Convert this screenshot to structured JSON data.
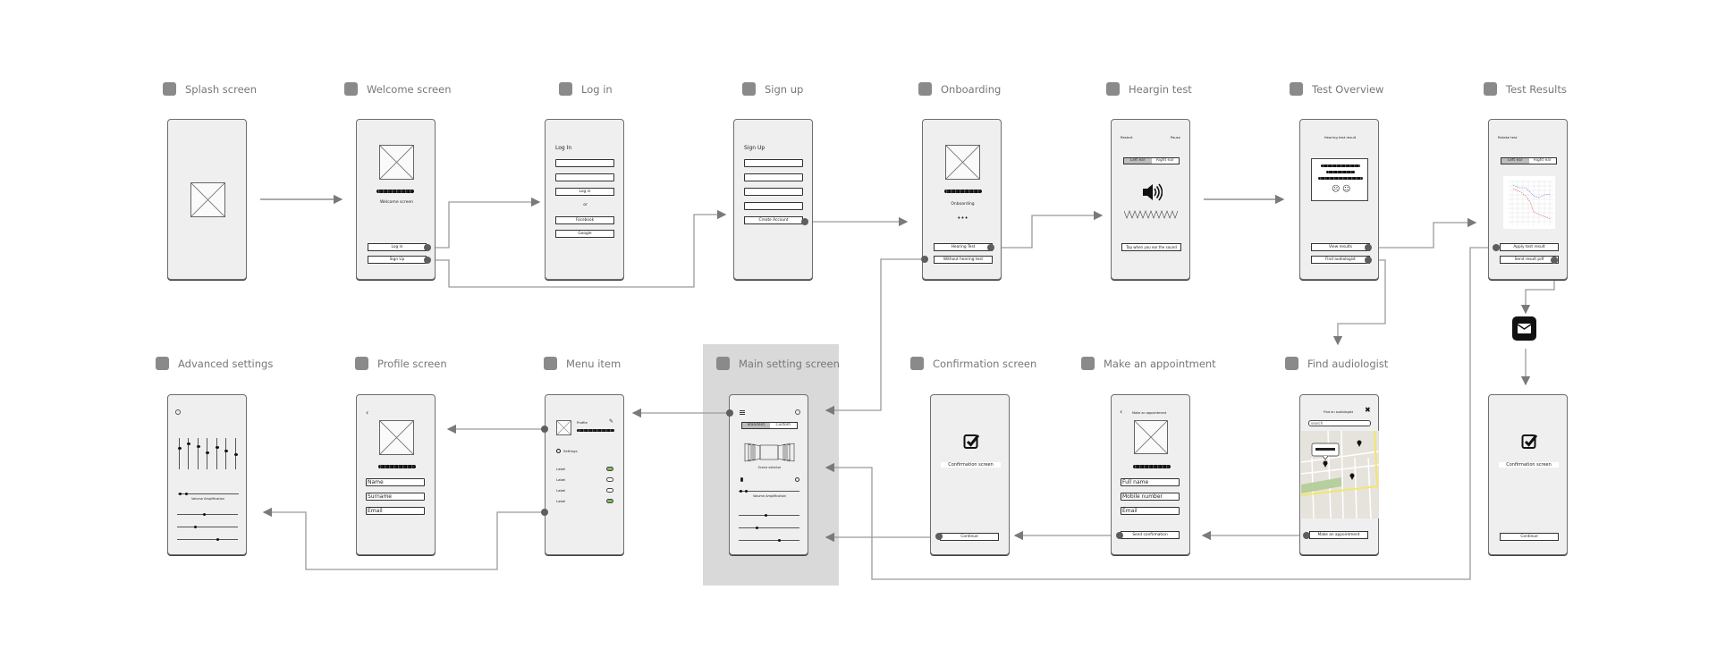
{
  "diagram": {
    "type": "wireframe-user-flow",
    "screens": [
      {
        "id": "splash",
        "title": "Splash screen"
      },
      {
        "id": "welcome",
        "title": "Welcome screen",
        "text": "Welcome screen",
        "buttons": [
          "Log in",
          "Sign Up"
        ]
      },
      {
        "id": "login",
        "title": "Log in",
        "heading": "Log In",
        "buttons": [
          "Log in",
          "Facebook",
          "Google"
        ],
        "separator": "or"
      },
      {
        "id": "signup",
        "title": "Sign up",
        "heading": "Sign Up",
        "buttons": [
          "Create Account"
        ]
      },
      {
        "id": "onboarding",
        "title": "Onboarding",
        "text": "Onboarding",
        "pager": "•••",
        "buttons": [
          "Hearing Test",
          "Without hearing test"
        ]
      },
      {
        "id": "hearing_test",
        "title": "Heargin test",
        "top_left": "Restart",
        "top_right": "Pause",
        "segments": [
          "Left ear",
          "Right ear"
        ],
        "buttons": [
          "Tap when you ear the sound"
        ]
      },
      {
        "id": "test_overview",
        "title": "Test Overview",
        "heading": "Hearing test result",
        "buttons": [
          "View results",
          "Find audiologist"
        ]
      },
      {
        "id": "test_results",
        "title": "Test Results",
        "heading": "Retake test",
        "segments": [
          "Left ear",
          "Right ear"
        ],
        "buttons": [
          "Apply test result",
          "Send result pdf"
        ]
      },
      {
        "id": "advanced_settings",
        "title": "Advanced settings",
        "slider_label": "Volume Amplification"
      },
      {
        "id": "profile",
        "title": "Profile screen",
        "fields": [
          "Name",
          "Surname",
          "Email"
        ]
      },
      {
        "id": "menu",
        "title": "Menu item",
        "profile_label": "Profile",
        "settings_label": "Settings",
        "rows": [
          {
            "label": "Label",
            "on": true
          },
          {
            "label": "Label",
            "on": false
          },
          {
            "label": "Label",
            "on": false
          },
          {
            "label": "Label",
            "on": true
          }
        ]
      },
      {
        "id": "main_setting",
        "title": "Main setting screen",
        "segments": [
          "Standard",
          "Custom"
        ],
        "scene_label": "Scene selector",
        "slider_label": "Volume Amplification"
      },
      {
        "id": "confirmation",
        "title": "Confirmation screen",
        "text": "Confirmation screen",
        "buttons": [
          "Continue"
        ]
      },
      {
        "id": "appointment",
        "title": "Make an appointment",
        "heading": "Make an appointment",
        "fields": [
          "Full name",
          "Mobile number",
          "Email"
        ],
        "buttons": [
          "Send confirmation"
        ]
      },
      {
        "id": "find_audiologist",
        "title": "Find audiologist",
        "heading": "Find an audiologist",
        "search_placeholder": "search",
        "buttons": [
          "Make an appointment"
        ]
      },
      {
        "id": "confirmation_email",
        "title": "",
        "text": "Confirmation screen",
        "buttons": [
          "Continue"
        ]
      }
    ],
    "edges": [
      {
        "from": "splash",
        "to": "welcome"
      },
      {
        "from": "welcome.Log in",
        "to": "login"
      },
      {
        "from": "welcome.Sign Up",
        "to": "signup"
      },
      {
        "from": "signup.Create Account",
        "to": "onboarding"
      },
      {
        "from": "onboarding.Hearing Test",
        "to": "hearing_test"
      },
      {
        "from": "onboarding.Without hearing test",
        "to": "main_setting"
      },
      {
        "from": "hearing_test",
        "to": "test_overview"
      },
      {
        "from": "test_overview.View results",
        "to": "test_results"
      },
      {
        "from": "test_overview.Find audiologist",
        "to": "find_audiologist"
      },
      {
        "from": "test_results.Send result pdf",
        "to": "email"
      },
      {
        "from": "email",
        "to": "confirmation_email"
      },
      {
        "from": "test_results.Apply test result",
        "to": "main_setting"
      },
      {
        "from": "find_audiologist.Make an appointment",
        "to": "appointment"
      },
      {
        "from": "appointment.Send confirmation",
        "to": "confirmation"
      },
      {
        "from": "confirmation.Continue",
        "to": "main_setting"
      },
      {
        "from": "main_setting.menu",
        "to": "menu"
      },
      {
        "from": "menu.Profile",
        "to": "profile"
      },
      {
        "from": "menu.Settings",
        "to": "advanced_settings"
      }
    ],
    "colors": {
      "frame_fill": "#efefef",
      "connector": "#9a9a9a",
      "highlight": "#d9d9d9",
      "toggle_on": "#7bbd5a",
      "map_road": "#f2e66d",
      "map_park": "#b6cf9c"
    }
  }
}
